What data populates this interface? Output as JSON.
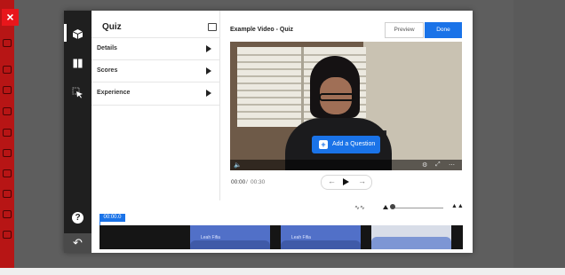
{
  "app": {
    "close_label": "×"
  },
  "panel": {
    "title": "Quiz",
    "sections": [
      {
        "label": "Details"
      },
      {
        "label": "Scores"
      },
      {
        "label": "Experience"
      }
    ]
  },
  "rail": {
    "icons": [
      "cube-icon",
      "book-icon",
      "cursor-icon"
    ],
    "help_label": "?",
    "back_label": "↶"
  },
  "editor": {
    "video_title": "Example Video - Quiz",
    "preview_label": "Preview",
    "done_label": "Done",
    "add_question_label": "Add a Question",
    "add_question_icon": "+",
    "current_time": "00:00",
    "separator": "/",
    "total_time": "00:30",
    "prev_icon": "←",
    "next_icon": "→"
  },
  "timeline": {
    "cursor_time": "00:00.0",
    "segments": [
      "Leah Fifia",
      "Leah Fifia"
    ]
  },
  "colors": {
    "accent": "#1a73e8",
    "rail": "#1f1f1f",
    "close": "#e8161b"
  }
}
